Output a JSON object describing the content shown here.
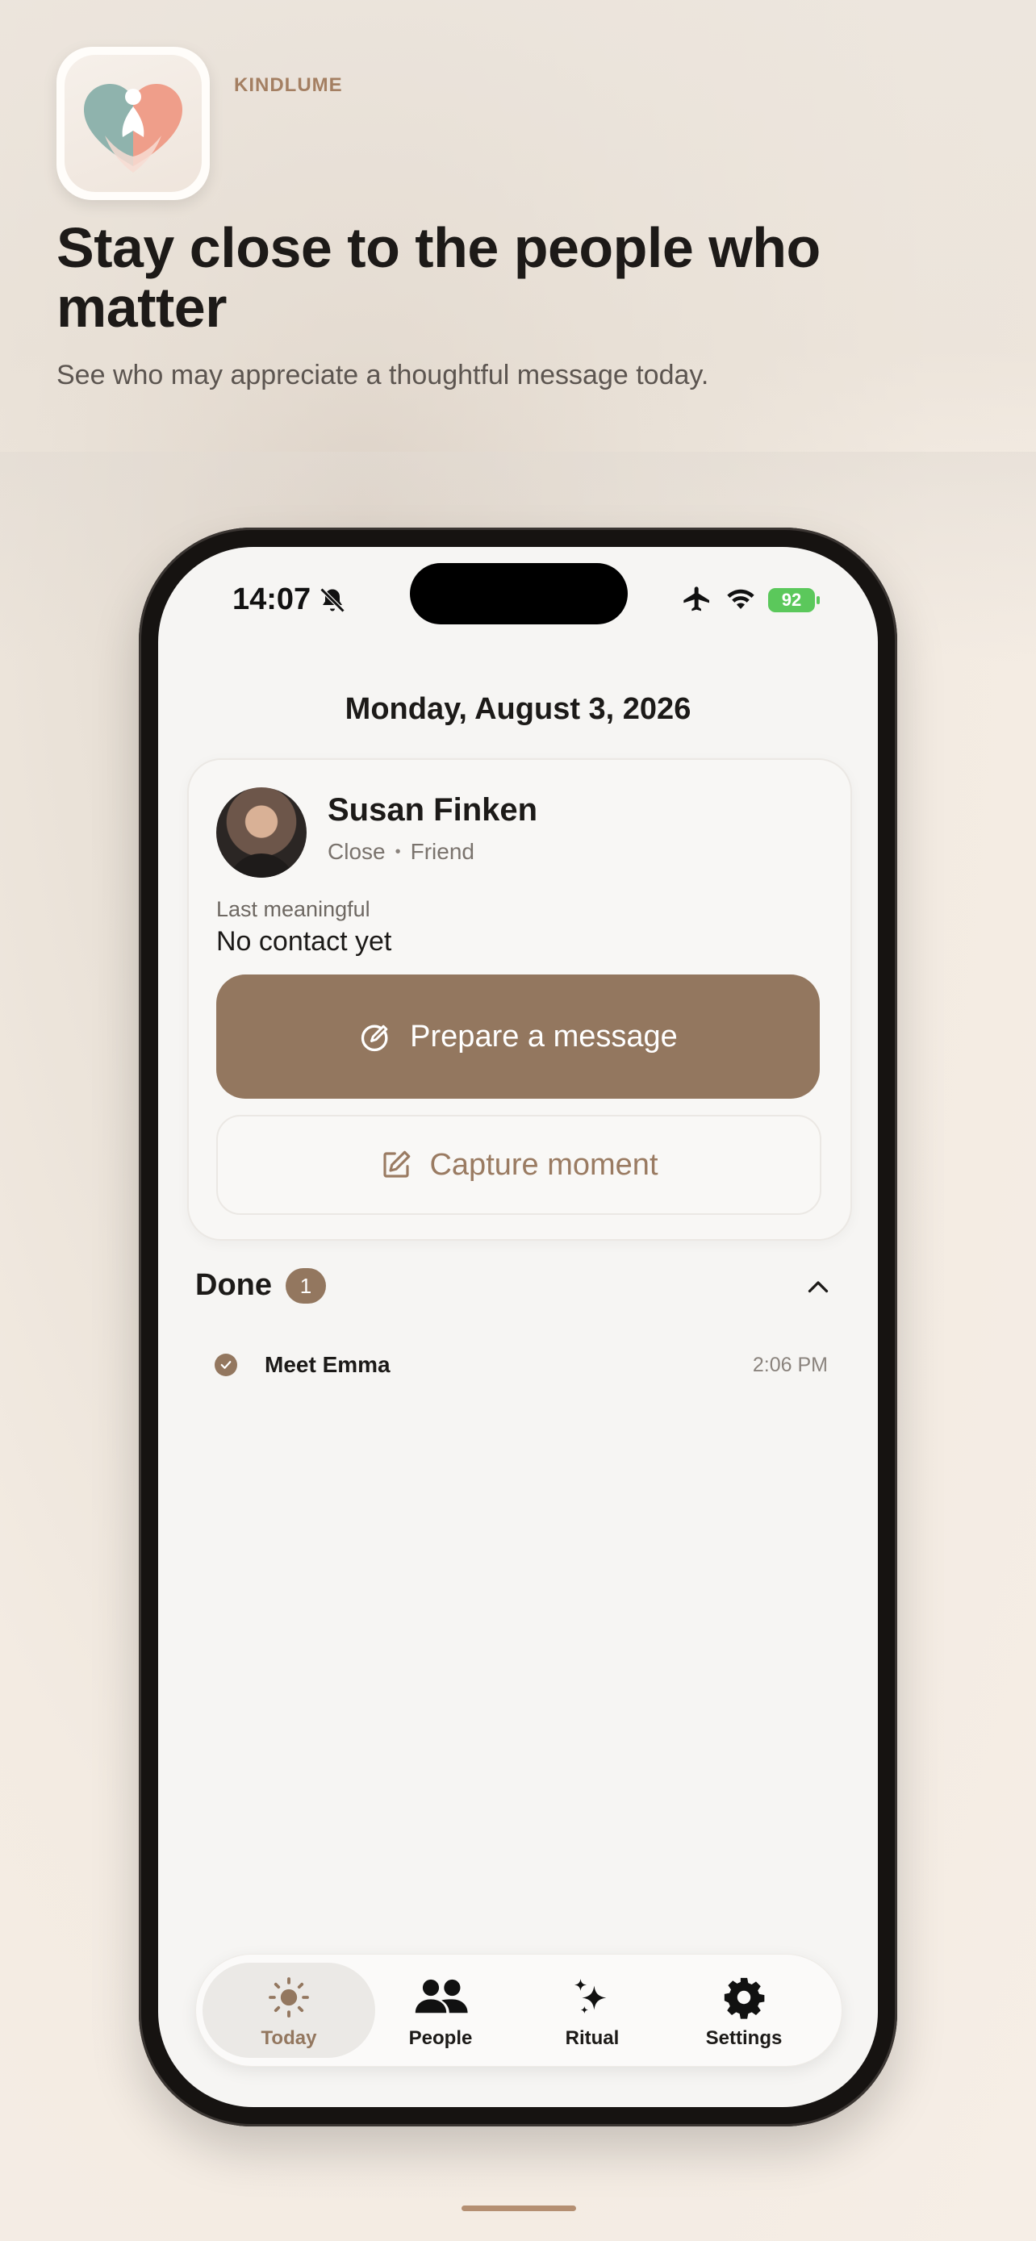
{
  "app": {
    "brand": "KINDLUME",
    "headline": "Stay close to the people who matter",
    "subhead": "See who may appreciate a thoughtful message today.",
    "icon": "heart-hands-logo"
  },
  "status_bar": {
    "time": "14:07",
    "battery": "92",
    "icons": [
      "bell-slash-icon",
      "airplane-icon",
      "wifi-icon",
      "battery-icon"
    ]
  },
  "today": {
    "date": "Monday, August 3, 2026",
    "person": {
      "name": "Susan Finken",
      "closeness": "Close",
      "relation": "Friend",
      "last_label": "Last meaningful",
      "last_value": "No contact yet"
    },
    "primary_action": "Prepare a message",
    "secondary_action": "Capture moment",
    "done": {
      "title": "Done",
      "count": "1",
      "items": [
        {
          "title": "Meet Emma",
          "time": "2:06 PM"
        }
      ]
    }
  },
  "tabs": [
    {
      "label": "Today",
      "icon": "sun-icon",
      "active": true
    },
    {
      "label": "People",
      "icon": "people-icon",
      "active": false
    },
    {
      "label": "Ritual",
      "icon": "sparkles-icon",
      "active": false
    },
    {
      "label": "Settings",
      "icon": "gear-icon",
      "active": false
    }
  ],
  "colors": {
    "accent": "#93775f",
    "brand_text": "#a47f62",
    "battery": "#5bc85b"
  }
}
